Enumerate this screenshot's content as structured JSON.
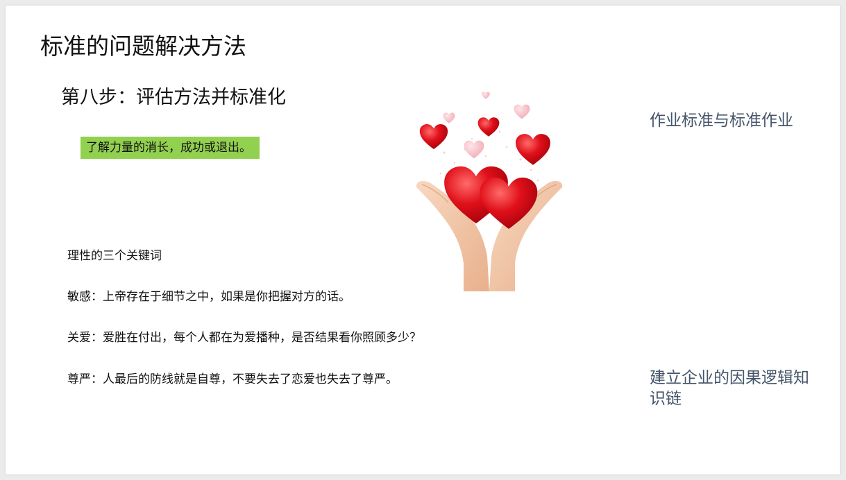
{
  "slide": {
    "title": "标准的问题解决方法",
    "step_title": "第八步：评估方法并标准化",
    "highlight_text": "了解力量的消长，成功或退出。",
    "keywords_heading": "理性的三个关键词",
    "keyword_sensitivity": "敏感：上帝存在于细节之中，如果是你把握对方的话。",
    "keyword_care": "关爱：爱胜在付出，每个人都在为爱播种，是否结果看你照顾多少？",
    "keyword_dignity": "尊严：人最后的防线就是自尊，不要失去了恋爱也失去了尊严。",
    "side_label_top": "作业标准与标准作业",
    "side_label_bottom": "建立企业的因果逻辑知识链"
  },
  "colors": {
    "highlight_bg": "#92d050",
    "side_text": "#44546a",
    "heart_red": "#e0101a",
    "heart_pink": "#f4b6be",
    "skin": "#f2c4a4"
  },
  "illustration": {
    "icon": "hearts-in-hands-icon"
  }
}
